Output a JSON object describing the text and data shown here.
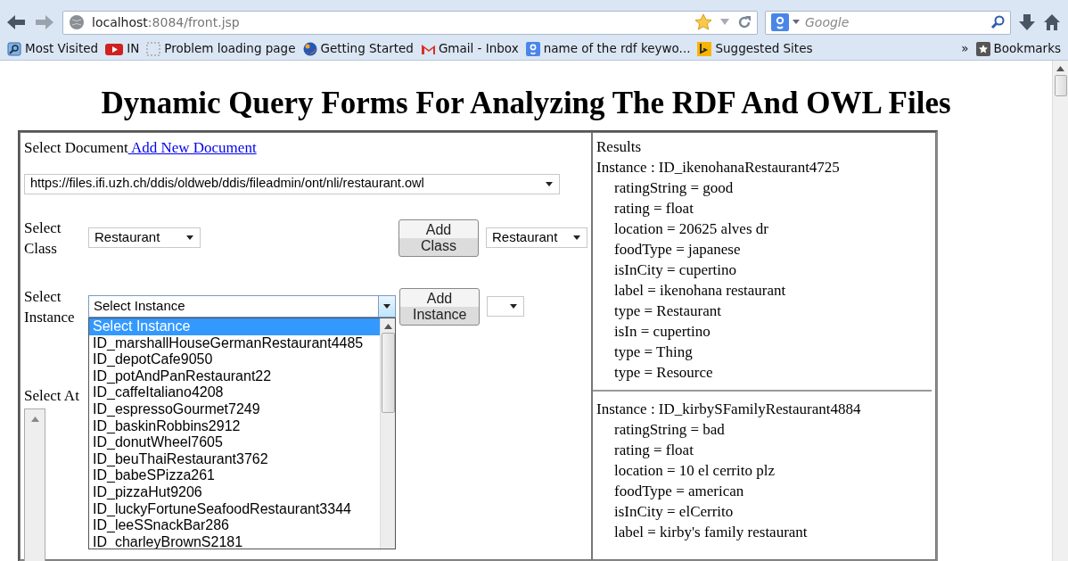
{
  "browser": {
    "address": {
      "host": "localhost",
      "path": ":8084/front.jsp"
    },
    "search": {
      "placeholder": "Google"
    },
    "bookmarks": [
      {
        "label": "Most Visited",
        "kind": "folder"
      },
      {
        "label": "IN",
        "kind": "video"
      },
      {
        "label": "Problem loading page",
        "kind": "blank"
      },
      {
        "label": "Getting Started",
        "kind": "globe"
      },
      {
        "label": "Gmail - Inbox",
        "kind": "mail"
      },
      {
        "label": "name of the rdf keywo...",
        "kind": "search"
      },
      {
        "label": "Suggested Sites",
        "kind": "sites"
      }
    ],
    "overflow": "»",
    "bookmarks_menu": "Bookmarks"
  },
  "page": {
    "title": "Dynamic Query Forms For Analyzing The RDF And OWL Files",
    "document": {
      "label": "Select Document",
      "link": " Add New Document",
      "value": "https://files.ifi.uzh.ch/ddis/oldweb/ddis/fileadmin/ont/nli/restaurant.owl"
    },
    "class_row": {
      "label": "Select Class",
      "value": "Restaurant",
      "button": "Add Class",
      "second_value": "Restaurant"
    },
    "instance_row": {
      "label": "Select Instance",
      "value": "Select Instance",
      "button": "Add Instance",
      "expanded": true,
      "options": [
        {
          "label": "Select Instance",
          "selected": true
        },
        {
          "label": "ID_marshallHouseGermanRestaurant4485",
          "selected": false
        },
        {
          "label": "ID_depotCafe9050",
          "selected": false
        },
        {
          "label": "ID_potAndPanRestaurant22",
          "selected": false
        },
        {
          "label": "ID_caffeItaliano4208",
          "selected": false
        },
        {
          "label": "ID_espressoGourmet7249",
          "selected": false
        },
        {
          "label": "ID_baskinRobbins2912",
          "selected": false
        },
        {
          "label": "ID_donutWheel7605",
          "selected": false
        },
        {
          "label": "ID_beuThaiRestaurant3762",
          "selected": false
        },
        {
          "label": "ID_babeSPizza261",
          "selected": false
        },
        {
          "label": "ID_pizzaHut9206",
          "selected": false
        },
        {
          "label": "ID_luckyFortuneSeafoodRestaurant3344",
          "selected": false
        },
        {
          "label": "ID_leeSSnackBar286",
          "selected": false
        },
        {
          "label": "ID_charleyBrownS2181",
          "selected": false
        }
      ]
    },
    "attribute": {
      "label": "Select At"
    },
    "results": {
      "heading": "Results",
      "instances": [
        {
          "name": "Instance : ID_ikenohanaRestaurant4725",
          "properties": [
            "ratingString = good",
            "rating = float",
            "location = 20625 alves dr",
            "foodType = japanese",
            "isInCity = cupertino",
            "label = ikenohana restaurant",
            "type = Restaurant",
            "isIn = cupertino",
            "type = Thing",
            "type = Resource"
          ]
        },
        {
          "name": "Instance : ID_kirbySFamilyRestaurant4884",
          "properties": [
            "ratingString = bad",
            "rating = float",
            "location = 10 el cerrito plz",
            "foodType = american",
            "isInCity = elCerrito",
            "label = kirby's family restaurant"
          ]
        }
      ]
    }
  }
}
